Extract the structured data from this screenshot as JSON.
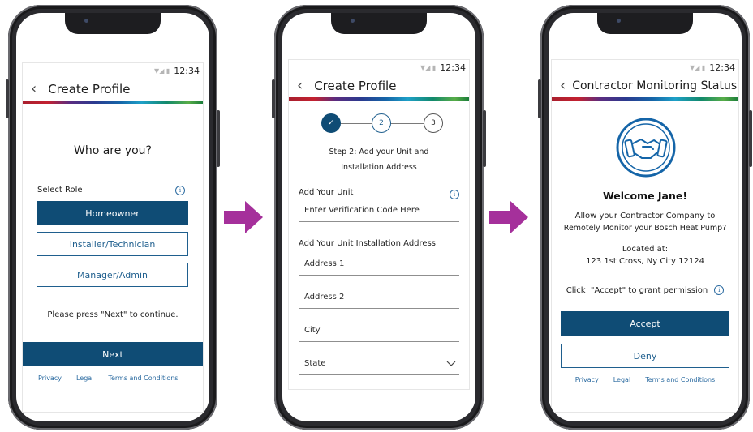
{
  "status_time": "12:34",
  "screen1": {
    "title": "Create Profile",
    "heading": "Who are you?",
    "select_role_label": "Select Role",
    "roles": [
      "Homeowner",
      "Installer/Technician",
      "Manager/Admin"
    ],
    "selected_role": "Homeowner",
    "prompt": "Please press \"Next\" to continue.",
    "next_label": "Next",
    "links": [
      "Privacy",
      "Legal",
      "Terms and Conditions"
    ]
  },
  "screen2": {
    "title": "Create Profile",
    "steps": {
      "completed": "✓",
      "current": "2",
      "next": "3"
    },
    "step_heading_line1": "Step 2: Add your Unit and",
    "step_heading_line2": "Installation Address",
    "add_unit_label": "Add Your Unit",
    "verification_placeholder": "Enter Verification Code Here",
    "address_section_label": "Add Your Unit Installation Address",
    "fields": {
      "address1": "Address 1",
      "address2": "Address 2",
      "city": "City",
      "state": "State"
    }
  },
  "screen3": {
    "title": "Contractor Monitoring Status",
    "welcome": "Welcome Jane!",
    "message_line1": "Allow your Contractor Company to",
    "message_line2": "Remotely Monitor your Bosch Heat Pump?",
    "located_label": "Located at:",
    "address": "123 1st Cross, Ny City 12124",
    "permission_text": "Click  \"Accept\" to grant permission",
    "accept_label": "Accept",
    "deny_label": "Deny",
    "links": [
      "Privacy",
      "Legal",
      "Terms and Conditions"
    ]
  },
  "colors": {
    "primary": "#0f4c75",
    "arrow": "#a5309b",
    "link": "#2a6aa0",
    "icon_blue": "#1565a8"
  },
  "icons": [
    "back-chevron-icon",
    "info-icon",
    "chevron-down-icon",
    "handshake-icon",
    "checkmark-icon",
    "arrow-right-icon"
  ]
}
